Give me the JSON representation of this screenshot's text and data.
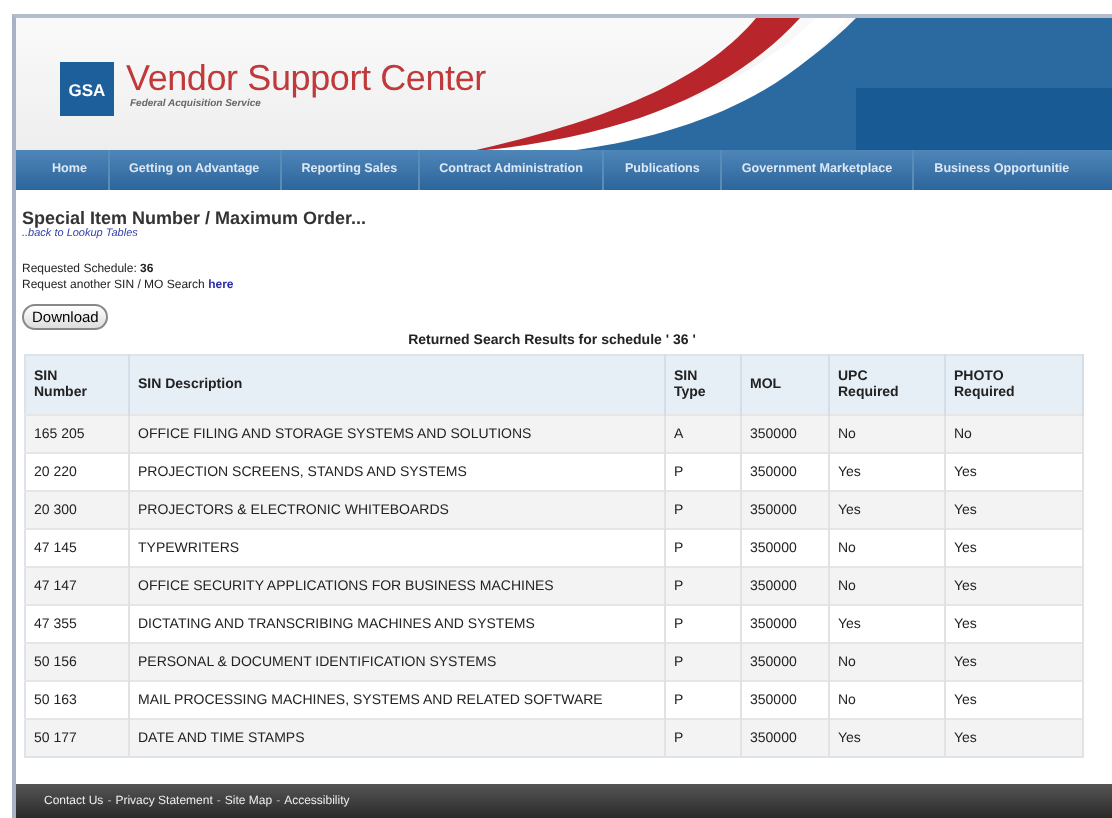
{
  "header": {
    "logo": "GSA",
    "title": "Vendor Support Center",
    "subtitle": "Federal Acquisition Service"
  },
  "nav": [
    {
      "label": "Home"
    },
    {
      "label": "Getting on Advantage"
    },
    {
      "label": "Reporting Sales"
    },
    {
      "label": "Contract Administration"
    },
    {
      "label": "Publications"
    },
    {
      "label": "Government Marketplace"
    },
    {
      "label": "Business Opportunitie"
    }
  ],
  "page": {
    "heading": "Special Item Number / Maximum Order...",
    "back_link": "..back to Lookup Tables",
    "schedule_label": "Requested Schedule:",
    "schedule_value": "36",
    "search_text": "Request another SIN / MO Search",
    "search_link": "here",
    "download_button": "Download",
    "results_caption": "Returned Search Results for schedule ' 36 '"
  },
  "table": {
    "columns": [
      "SIN Number",
      "SIN Description",
      "SIN Type",
      "MOL",
      "UPC Required",
      "PHOTO Required"
    ],
    "rows": [
      [
        "165 205",
        "OFFICE FILING AND STORAGE SYSTEMS AND SOLUTIONS",
        "A",
        "350000",
        "No",
        "No"
      ],
      [
        "20 220",
        "PROJECTION SCREENS, STANDS AND SYSTEMS",
        "P",
        "350000",
        "Yes",
        "Yes"
      ],
      [
        "20 300",
        "PROJECTORS & ELECTRONIC WHITEBOARDS",
        "P",
        "350000",
        "Yes",
        "Yes"
      ],
      [
        "47 145",
        "TYPEWRITERS",
        "P",
        "350000",
        "No",
        "Yes"
      ],
      [
        "47 147",
        "OFFICE SECURITY APPLICATIONS FOR BUSINESS MACHINES",
        "P",
        "350000",
        "No",
        "Yes"
      ],
      [
        "47 355",
        "DICTATING AND TRANSCRIBING MACHINES AND SYSTEMS",
        "P",
        "350000",
        "Yes",
        "Yes"
      ],
      [
        "50 156",
        "PERSONAL & DOCUMENT IDENTIFICATION SYSTEMS",
        "P",
        "350000",
        "No",
        "Yes"
      ],
      [
        "50 163",
        "MAIL PROCESSING MACHINES, SYSTEMS AND RELATED SOFTWARE",
        "P",
        "350000",
        "No",
        "Yes"
      ],
      [
        "50 177",
        "DATE AND TIME STAMPS",
        "P",
        "350000",
        "Yes",
        "Yes"
      ]
    ]
  },
  "footer": {
    "separator": "-",
    "links": [
      "Contact Us",
      "Privacy Statement",
      "Site Map",
      "Accessibility"
    ]
  }
}
